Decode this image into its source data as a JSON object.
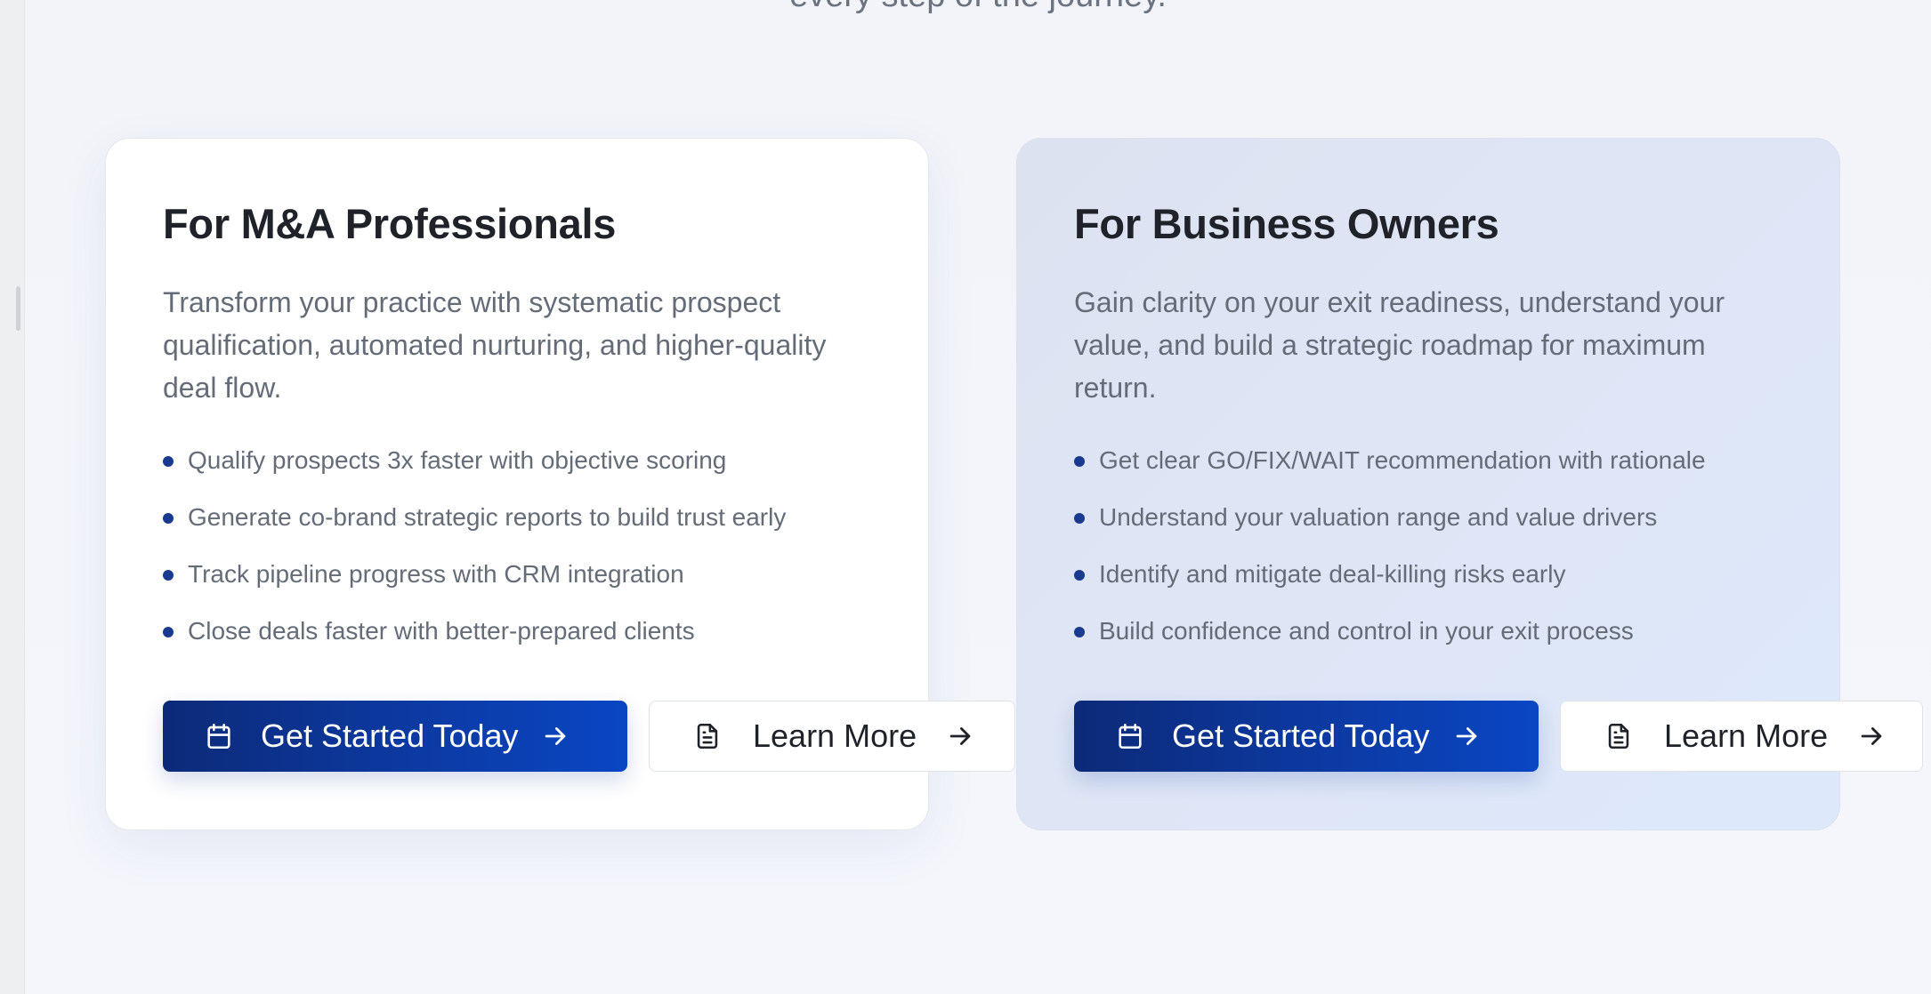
{
  "section": {
    "subtitle_cut": "every step of the journey."
  },
  "cards": [
    {
      "title": "For M&A Professionals",
      "description": "Transform your practice with systematic prospect qualification, automated nurturing, and higher-quality deal flow.",
      "bullets": [
        "Qualify prospects 3x faster with objective scoring",
        "Generate co-brand strategic reports to build trust early",
        "Track pipeline progress with CRM integration",
        "Close deals faster with better-prepared clients"
      ],
      "primary_button": {
        "label": "Get Started Today",
        "icon": "calendar-icon"
      },
      "secondary_button": {
        "label": "Learn More",
        "icon": "document-icon"
      }
    },
    {
      "title": "For Business Owners",
      "description": "Gain clarity on your exit readiness, understand your value, and build a strategic roadmap for maximum return.",
      "bullets": [
        "Get clear GO/FIX/WAIT recommendation with rationale",
        "Understand your valuation range and value drivers",
        "Identify and mitigate deal-killing risks early",
        "Build confidence and control in your exit process"
      ],
      "primary_button": {
        "label": "Get Started Today",
        "icon": "calendar-icon"
      },
      "secondary_button": {
        "label": "Learn More",
        "icon": "document-icon"
      }
    }
  ],
  "colors": {
    "primary_button_start": "#0c2a78",
    "primary_button_end": "#0946c3",
    "bullet_dot": "#1a3a8f",
    "heading": "#1f2329",
    "body_text": "#646c78"
  }
}
